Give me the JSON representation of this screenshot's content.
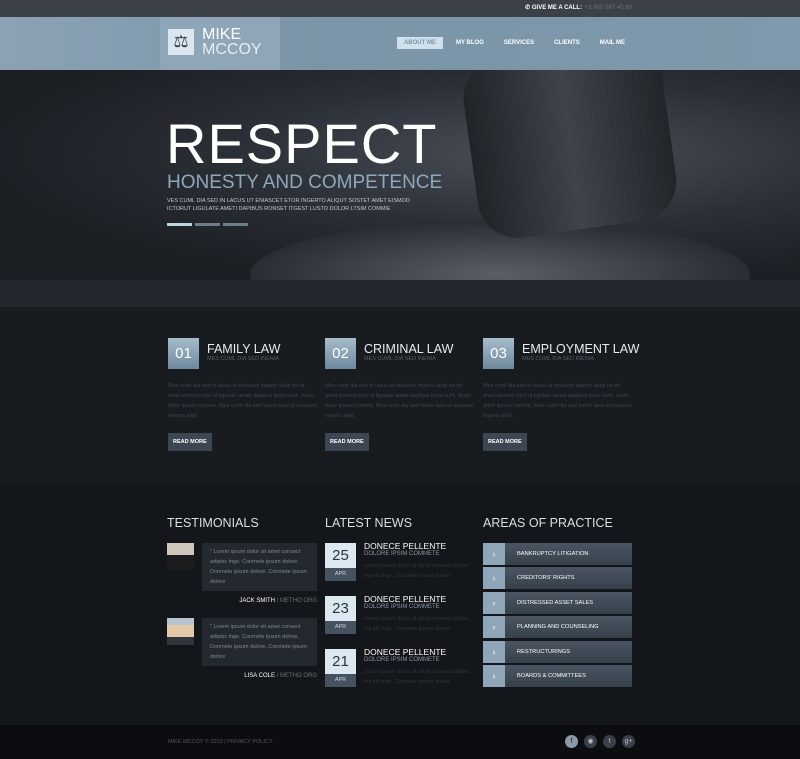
{
  "topbar": {
    "call_label": "GIVE ME A CALL:",
    "phone": "+1 800 567 45 89"
  },
  "logo": {
    "first": "MIKE",
    "last": "MCCOY",
    "icon": "scales-icon"
  },
  "nav": [
    {
      "label": "ABOUT ME",
      "active": true
    },
    {
      "label": "MY BLOG"
    },
    {
      "label": "SERVICES"
    },
    {
      "label": "CLIENTS"
    },
    {
      "label": "MAIL ME"
    }
  ],
  "hero": {
    "title": "RESPECT",
    "subtitle": "HONESTY AND COMPETENCE",
    "text": "VES CUML DIA SED IN LACUS UT ENIASCET ETOR INGERTO ALIQUT SOSTET AMET EISMOD ICTORUT LIGULATE AMETI DAPIBUS RONSET ITGEST LUSTO DOLOR LTSIM COMMIE",
    "slides": 3,
    "active_slide": 1
  },
  "services": [
    {
      "num": "01",
      "title": "FAMILY LAW",
      "sub": "MES CUML DIA SED INENIA",
      "text": "Mes cuml dia sed in lacus ut eniascet ingerto aliiqt es sit amet eismod ictor ut ligulate ameti dapibus ticdu nunt. Justo dolor ipsum comme. Mes cuml dia sed inerto lacu ut eniascet ingerto aliqt.",
      "button": "READ MORE"
    },
    {
      "num": "02",
      "title": "CRIMINAL LAW",
      "sub": "MES CUML DIA SED INENIA",
      "text": "Mes cuml dia sed in lacus ut eniascet ingerto aliiqt es sit amet eismod ictor ut ligulate ameti dapibus ticdu nunt. Justo dolor ipsum comme. Mes cuml dia sed inerto lacu ut eniascet ingerto aliqt.",
      "button": "READ MORE"
    },
    {
      "num": "03",
      "title": "EMPLOYMENT LAW",
      "sub": "MES CUML DIA SED INENIA",
      "text": "Mes cuml dia sed in lacus ut eniascet ingerto aliiqt es sit amet eismod ictor ut ligulate ameti dapibus ticdu nunt. Justo dolor ipsum comme. Mes cuml dia sed inerto lacu ut eniascet ingerto aliqt.",
      "button": "READ MORE"
    }
  ],
  "testimonials": {
    "title": "TESTIMONIALS",
    "items": [
      {
        "quote": "\" Lorem ipsum dolor sit amet consect adipisc inge. Conmete ipsum dolore. Donmete ipsum dolore. Conmete ipsum dolore",
        "name": "JACK SMITH",
        "org": "METHO ORG"
      },
      {
        "quote": "\" Lorem ipsum dolor sit amet consect adipisc inge. Conmete ipsum dolore. Donmete ipsum dolore. Conmete ipsum dolore",
        "name": "LISA COLE",
        "org": "METHO ORG"
      }
    ]
  },
  "news": {
    "title": "LATEST NEWS",
    "items": [
      {
        "day": "25",
        "month": "APR",
        "title": "DONECE PELLENTE",
        "sub": "DOLORE IPSIM COMMETE",
        "text": "Lorem ipsum dolor sit amet consect adipisc ing elit inge. Conmete ipsum dolore."
      },
      {
        "day": "23",
        "month": "APR",
        "title": "DONECE PELLENTE",
        "sub": "DOLORE IPSIM COMMETE",
        "text": "Lorem ipsum dolor sit amet consect adipisc ing elit inge. Conmete ipsum dolore."
      },
      {
        "day": "21",
        "month": "APR",
        "title": "DONECE PELLENTE",
        "sub": "DOLORE IPSIM COMMETE",
        "text": "Lorem ipsum dolor sit amet consect adipisc ing elit inge. Conmete ipsum dolore."
      }
    ]
  },
  "practice": {
    "title": "AREAS OF PRACTICE",
    "items": [
      "BANKRUPTCY LITIGATION",
      "CREDITORS' RIGHTS",
      "DISTRESSED ASSET SALES",
      "PLANNING AND COUNSELING",
      "RESTRUCTURINGS",
      "BOARDS & COMMITTEES"
    ]
  },
  "footer": {
    "copyright": "MIKE MCCOY © 2013 | PRIVACY POLICY",
    "social": [
      "facebook-icon",
      "rss-icon",
      "twitter-icon",
      "google-plus-icon"
    ]
  }
}
